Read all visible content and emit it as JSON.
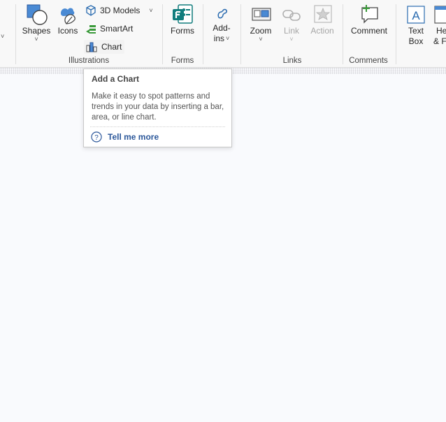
{
  "ribbon": {
    "groups": {
      "illustrations": "Illustrations",
      "forms": "Forms",
      "links": "Links",
      "comments": "Comments"
    },
    "buttons": {
      "shapes": "Shapes",
      "icons": "Icons",
      "models_3d": "3D Models",
      "smartart": "SmartArt",
      "chart": "Chart",
      "forms": "Forms",
      "addins_line1": "Add-",
      "addins_line2": "ins",
      "zoom": "Zoom",
      "link": "Link",
      "action": "Action",
      "comment": "Comment",
      "textbox_line1": "Text",
      "textbox_line2": "Box",
      "header_line1": "He",
      "header_line2": "& F"
    },
    "icon_names": {
      "shapes": "shapes-icon",
      "icons": "icons-icon",
      "models_3d": "cube-3d-icon",
      "smartart": "smartart-icon",
      "chart": "chart-icon",
      "forms": "forms-icon",
      "addins": "addins-icon",
      "zoom": "zoom-icon",
      "link": "link-icon",
      "action": "action-star-icon",
      "comment": "comment-icon",
      "textbox": "text-box-icon",
      "help": "help-question-icon"
    },
    "chevron": "˅",
    "colors": {
      "accent_blue": "#2b579a",
      "forms_green": "#107c7c",
      "comment_green": "#3a9a3a",
      "icon_blue": "#3a78c2"
    }
  },
  "tooltip": {
    "title": "Add a Chart",
    "body": "Make it easy to spot patterns and trends in your data by inserting a bar, area, or line chart.",
    "link": "Tell me more"
  }
}
